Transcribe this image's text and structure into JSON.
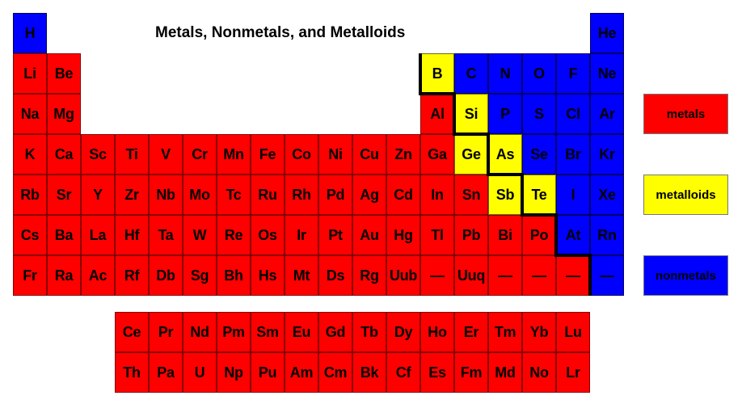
{
  "title": "Metals, Nonmetals, and Metalloids",
  "colors": {
    "metal": "#ff0000",
    "metalloid": "#ffff00",
    "nonmetal": "#0000ff",
    "boundary": "#000000"
  },
  "legend": [
    {
      "label": "metals",
      "category": "metal"
    },
    {
      "label": "metalloids",
      "category": "metalloid"
    },
    {
      "label": "nonmetals",
      "category": "nonmetal"
    }
  ],
  "main_table": [
    [
      [
        "H",
        "nonmetal",
        1
      ],
      [
        "He",
        "nonmetal",
        18
      ]
    ],
    [
      [
        "Li",
        "metal",
        1
      ],
      [
        "Be",
        "metal",
        2
      ],
      [
        "B",
        "metalloid",
        13
      ],
      [
        "C",
        "nonmetal",
        14
      ],
      [
        "N",
        "nonmetal",
        15
      ],
      [
        "O",
        "nonmetal",
        16
      ],
      [
        "F",
        "nonmetal",
        17
      ],
      [
        "Ne",
        "nonmetal",
        18
      ]
    ],
    [
      [
        "Na",
        "metal",
        1
      ],
      [
        "Mg",
        "metal",
        2
      ],
      [
        "Al",
        "metal",
        13
      ],
      [
        "Si",
        "metalloid",
        14
      ],
      [
        "P",
        "nonmetal",
        15
      ],
      [
        "S",
        "nonmetal",
        16
      ],
      [
        "Cl",
        "nonmetal",
        17
      ],
      [
        "Ar",
        "nonmetal",
        18
      ]
    ],
    [
      [
        "K",
        "metal",
        1
      ],
      [
        "Ca",
        "metal",
        2
      ],
      [
        "Sc",
        "metal",
        3
      ],
      [
        "Ti",
        "metal",
        4
      ],
      [
        "V",
        "metal",
        5
      ],
      [
        "Cr",
        "metal",
        6
      ],
      [
        "Mn",
        "metal",
        7
      ],
      [
        "Fe",
        "metal",
        8
      ],
      [
        "Co",
        "metal",
        9
      ],
      [
        "Ni",
        "metal",
        10
      ],
      [
        "Cu",
        "metal",
        11
      ],
      [
        "Zn",
        "metal",
        12
      ],
      [
        "Ga",
        "metal",
        13
      ],
      [
        "Ge",
        "metalloid",
        14
      ],
      [
        "As",
        "metalloid",
        15
      ],
      [
        "Se",
        "nonmetal",
        16
      ],
      [
        "Br",
        "nonmetal",
        17
      ],
      [
        "Kr",
        "nonmetal",
        18
      ]
    ],
    [
      [
        "Rb",
        "metal",
        1
      ],
      [
        "Sr",
        "metal",
        2
      ],
      [
        "Y",
        "metal",
        3
      ],
      [
        "Zr",
        "metal",
        4
      ],
      [
        "Nb",
        "metal",
        5
      ],
      [
        "Mo",
        "metal",
        6
      ],
      [
        "Tc",
        "metal",
        7
      ],
      [
        "Ru",
        "metal",
        8
      ],
      [
        "Rh",
        "metal",
        9
      ],
      [
        "Pd",
        "metal",
        10
      ],
      [
        "Ag",
        "metal",
        11
      ],
      [
        "Cd",
        "metal",
        12
      ],
      [
        "In",
        "metal",
        13
      ],
      [
        "Sn",
        "metal",
        14
      ],
      [
        "Sb",
        "metalloid",
        15
      ],
      [
        "Te",
        "metalloid",
        16
      ],
      [
        "I",
        "nonmetal",
        17
      ],
      [
        "Xe",
        "nonmetal",
        18
      ]
    ],
    [
      [
        "Cs",
        "metal",
        1
      ],
      [
        "Ba",
        "metal",
        2
      ],
      [
        "La",
        "metal",
        3
      ],
      [
        "Hf",
        "metal",
        4
      ],
      [
        "Ta",
        "metal",
        5
      ],
      [
        "W",
        "metal",
        6
      ],
      [
        "Re",
        "metal",
        7
      ],
      [
        "Os",
        "metal",
        8
      ],
      [
        "Ir",
        "metal",
        9
      ],
      [
        "Pt",
        "metal",
        10
      ],
      [
        "Au",
        "metal",
        11
      ],
      [
        "Hg",
        "metal",
        12
      ],
      [
        "Tl",
        "metal",
        13
      ],
      [
        "Pb",
        "metal",
        14
      ],
      [
        "Bi",
        "metal",
        15
      ],
      [
        "Po",
        "metal",
        16
      ],
      [
        "At",
        "nonmetal",
        17
      ],
      [
        "Rn",
        "nonmetal",
        18
      ]
    ],
    [
      [
        "Fr",
        "metal",
        1
      ],
      [
        "Ra",
        "metal",
        2
      ],
      [
        "Ac",
        "metal",
        3
      ],
      [
        "Rf",
        "metal",
        4
      ],
      [
        "Db",
        "metal",
        5
      ],
      [
        "Sg",
        "metal",
        6
      ],
      [
        "Bh",
        "metal",
        7
      ],
      [
        "Hs",
        "metal",
        8
      ],
      [
        "Mt",
        "metal",
        9
      ],
      [
        "Ds",
        "metal",
        10
      ],
      [
        "Rg",
        "metal",
        11
      ],
      [
        "Uub",
        "metal",
        12
      ],
      [
        "—",
        "metal",
        13
      ],
      [
        "Uuq",
        "metal",
        14
      ],
      [
        "—",
        "metal",
        15
      ],
      [
        "—",
        "metal",
        16
      ],
      [
        "—",
        "metal",
        17
      ],
      [
        "—",
        "nonmetal",
        18
      ]
    ]
  ],
  "f_block": [
    [
      "Ce",
      "Pr",
      "Nd",
      "Pm",
      "Sm",
      "Eu",
      "Gd",
      "Tb",
      "Dy",
      "Ho",
      "Er",
      "Tm",
      "Yb",
      "Lu"
    ],
    [
      "Th",
      "Pa",
      "U",
      "Np",
      "Pu",
      "Am",
      "Cm",
      "Bk",
      "Cf",
      "Es",
      "Fm",
      "Md",
      "No",
      "Lr"
    ]
  ],
  "f_block_category": "metal"
}
